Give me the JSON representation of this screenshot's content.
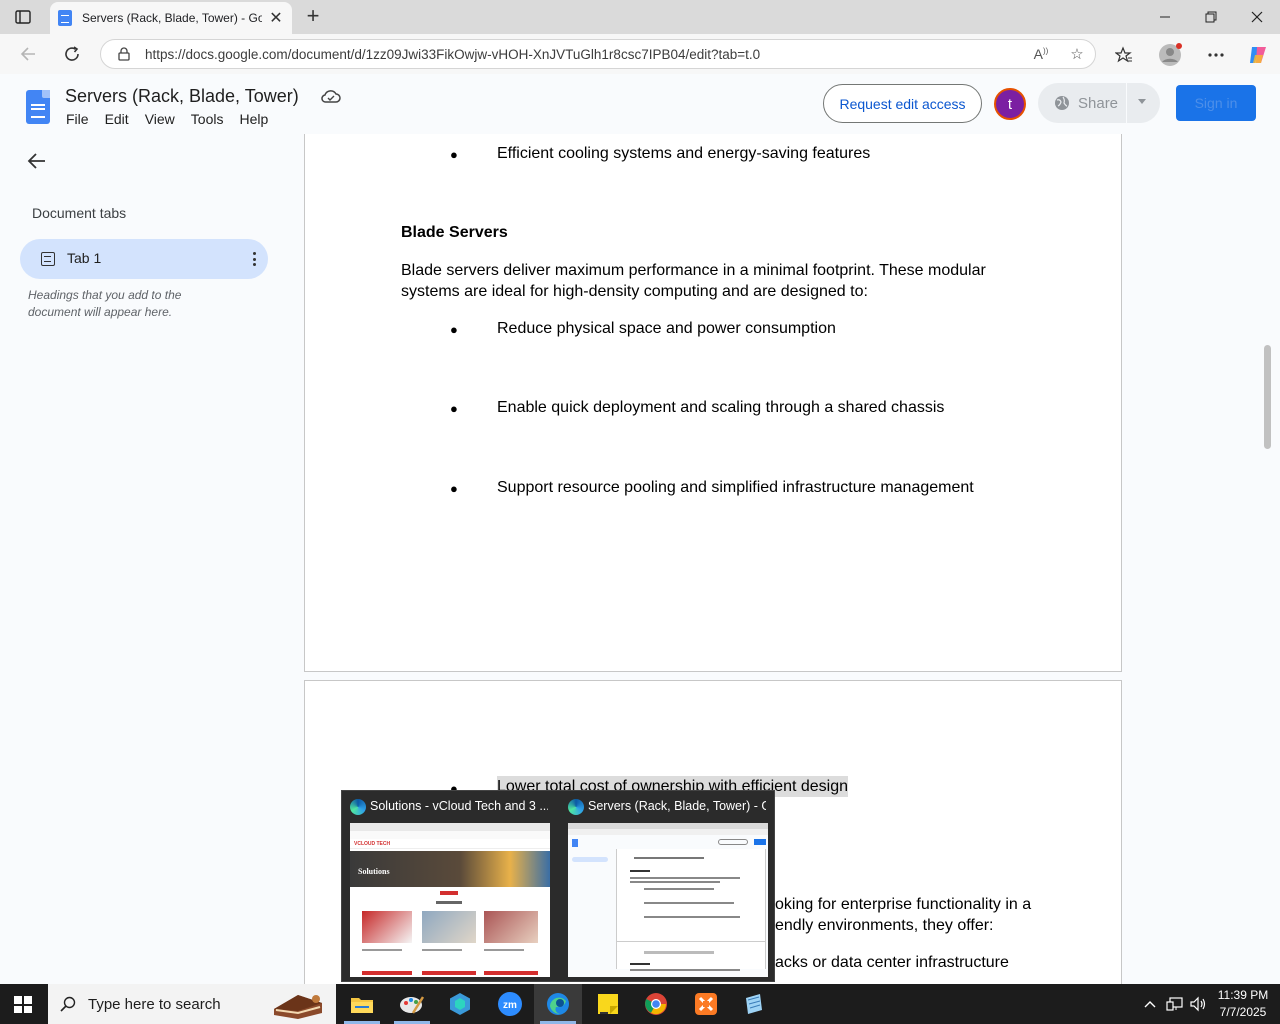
{
  "browser": {
    "tab_title": "Servers (Rack, Blade, Tower) - Goo",
    "url": "https://docs.google.com/document/d/1zz09Jwi33FikOwjw-vHOH-XnJVTuGlh1r8csc7IPB04/edit?tab=t.0"
  },
  "docs": {
    "title": "Servers (Rack, Blade, Tower)",
    "menu": [
      "File",
      "Edit",
      "View",
      "Tools",
      "Help"
    ],
    "request_edit": "Request edit access",
    "avatar_letter": "t",
    "share": "Share",
    "sign_in": "Sign in"
  },
  "sidebar": {
    "heading": "Document tabs",
    "tab_label": "Tab 1",
    "hint": "Headings that you add to the document will appear here."
  },
  "document": {
    "bullet_top": "Efficient cooling systems and energy-saving features",
    "blade_heading": "Blade Servers",
    "blade_para_line1": "Blade servers deliver maximum performance in a minimal footprint. These modular",
    "blade_para_line2": "systems are ideal for high-density computing and are designed to:",
    "blade_bullets": [
      "Reduce physical space and power consumption",
      "Enable quick deployment and scaling through a shared chassis",
      "Support resource pooling and simplified infrastructure management"
    ],
    "page2_bullet_highlight": "Lower total cost of ownership with efficient design",
    "page2_line1": "oking for enterprise functionality in a",
    "page2_line2": "endly environments, they offer:",
    "page2_bullet_partial": "acks or data center infrastructure",
    "bullet_symbol": "●"
  },
  "taskbar_preview": {
    "window1_title": "Solutions - vCloud Tech and 3 ...",
    "window2_title": "Servers (Rack, Blade, Tower) - G...",
    "preview1_heading": "Solutions",
    "preview1_logo": "VCLOUD TECH"
  },
  "taskbar": {
    "search_placeholder": "Type here to search",
    "time": "11:39 PM",
    "date": "7/7/2025"
  },
  "colors": {
    "accent_blue": "#1a73e8",
    "tab_selected": "#d3e3fd",
    "avatar": "#7b1fa2",
    "taskbar": "#1c1c1c"
  }
}
